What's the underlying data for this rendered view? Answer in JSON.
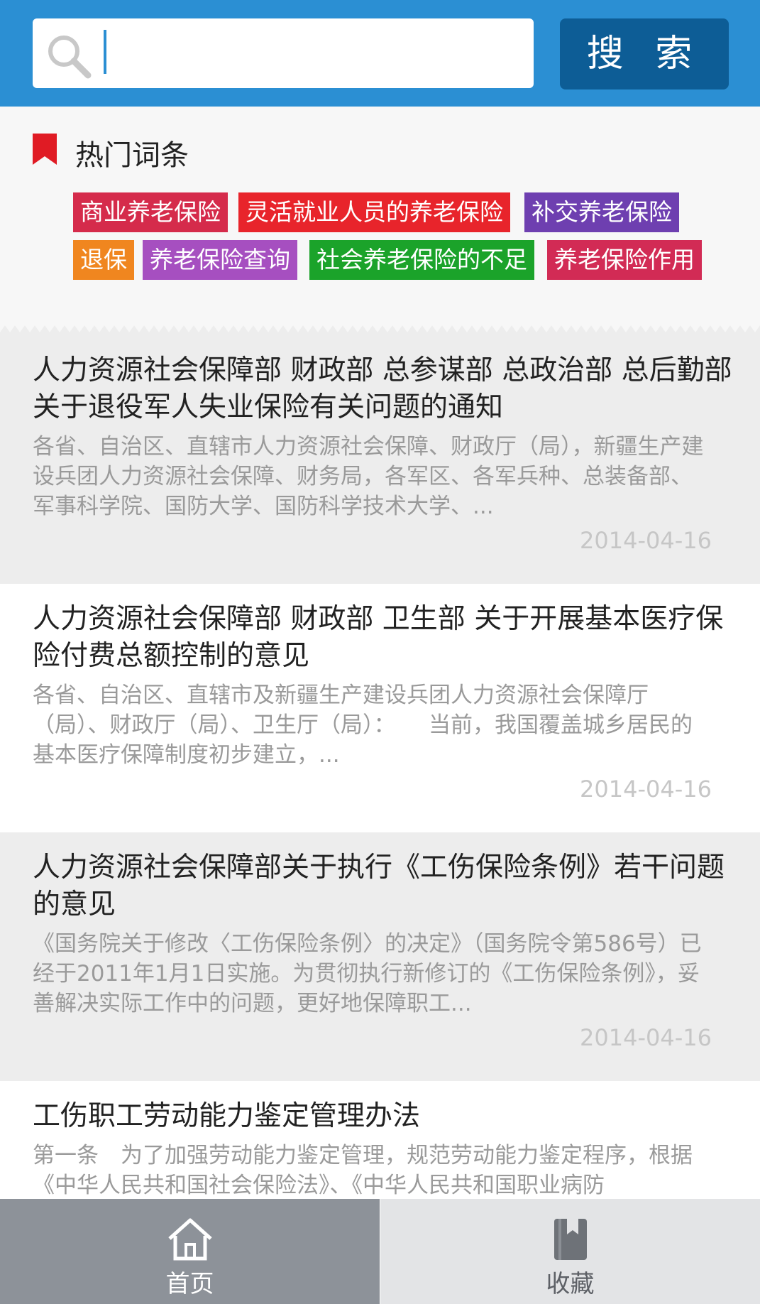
{
  "search": {
    "placeholder": "",
    "button_label": "搜 索"
  },
  "hot": {
    "title": "热门词条",
    "tags": [
      {
        "label": "商业养老保险",
        "color": "#d52b4b"
      },
      {
        "label": "灵活就业人员的养老保险",
        "color": "#e8242b"
      },
      {
        "label": "补交养老保险",
        "color": "#6e3fb0"
      },
      {
        "label": "退保",
        "color": "#f0861f"
      },
      {
        "label": "养老保险查询",
        "color": "#a64fc0"
      },
      {
        "label": "社会养老保险的不足",
        "color": "#1ba32a"
      },
      {
        "label": "养老保险作用",
        "color": "#d22b55"
      }
    ]
  },
  "articles": [
    {
      "title": "人力资源社会保障部 财政部 总参谋部 总政治部 总后勤部关于退役军人失业保险有关问题的通知",
      "summary": "各省、自治区、直辖市人力资源社会保障、财政厅（局），新疆生产建设兵团人力资源社会保障、财务局，各军区、各军兵种、总装备部、军事科学院、国防大学、国防科学技术大学、...",
      "date": "2014-04-16"
    },
    {
      "title": "人力资源社会保障部 财政部 卫生部 关于开展基本医疗保险付费总额控制的意见",
      "summary": "各省、自治区、直辖市及新疆生产建设兵团人力资源社会保障厅（局）、财政厅（局）、卫生厅（局）：　　当前，我国覆盖城乡居民的基本医疗保障制度初步建立，...",
      "date": "2014-04-16"
    },
    {
      "title": "人力资源社会保障部关于执行《工伤保险条例》若干问题的意见",
      "summary": "《国务院关于修改〈工伤保险条例〉的决定》（国务院令第586号）已经于2011年1月1日实施。为贯彻执行新修订的《工伤保险条例》，妥善解决实际工作中的问题，更好地保障职工...",
      "date": "2014-04-16"
    },
    {
      "title": "工伤职工劳动能力鉴定管理办法",
      "summary": "第一条　为了加强劳动能力鉴定管理，规范劳动能力鉴定程序，根据《中华人民共和国社会保险法》、《中华人民共和国职业病防",
      "date": ""
    }
  ],
  "nav": {
    "home_label": "首页",
    "favorites_label": "收藏"
  }
}
